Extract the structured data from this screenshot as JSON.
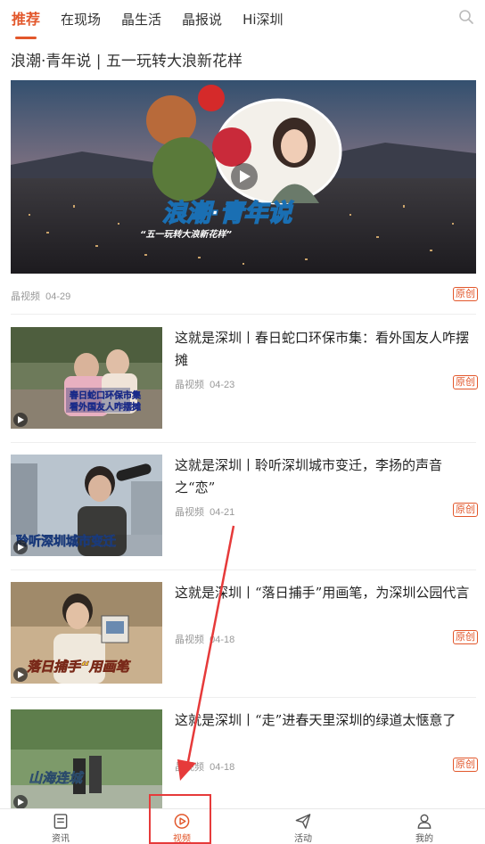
{
  "top_tabs": [
    {
      "label": "推荐"
    },
    {
      "label": "在现场"
    },
    {
      "label": "晶生活"
    },
    {
      "label": "晶报说"
    },
    {
      "label": "Hi深圳"
    }
  ],
  "icons": {
    "search": "search-icon",
    "play": "play-icon",
    "news": "news-icon",
    "video": "video-play-icon",
    "activity": "paper-plane-icon",
    "profile": "user-icon"
  },
  "colors": {
    "accent": "#e2572b",
    "annotation": "#e63a3a"
  },
  "headline": "浪潮·青年说 | 五一玩转大浪新花样",
  "hero": {
    "overlay_title": "浪潮·青年说",
    "overlay_subtitle": "“五一玩转大浪新花样”",
    "source": "晶视频",
    "date": "04-29",
    "badge": "原创"
  },
  "articles": [
    {
      "title": "这就是深圳丨春日蛇口环保市集：看外国友人咋摆摊",
      "source": "晶视频",
      "date": "04-23",
      "badge": "原创",
      "thumb_caption_1": "春日蛇口环保市集",
      "thumb_caption_2": "看外国友人咋摆摊"
    },
    {
      "title": "这就是深圳丨聆听深圳城市变迁，李扬的声音之“恋”",
      "source": "晶视频",
      "date": "04-21",
      "badge": "原创",
      "thumb_caption_1": "聆听深圳城市变迁"
    },
    {
      "title": "这就是深圳丨“落日捕手”用画笔，为深圳公园代言",
      "source": "晶视频",
      "date": "04-18",
      "badge": "原创",
      "thumb_caption_1": "落日捕手“用画笔"
    },
    {
      "title": "这就是深圳丨“走”进春天里深圳的绿道太惬意了",
      "source": "晶视频",
      "date": "04-18",
      "badge": "原创",
      "thumb_caption_1": "山海连城"
    }
  ],
  "bottom_nav": [
    {
      "label": "资讯",
      "active": false
    },
    {
      "label": "视频",
      "active": true
    },
    {
      "label": "活动",
      "active": false
    },
    {
      "label": "我的",
      "active": false
    }
  ]
}
